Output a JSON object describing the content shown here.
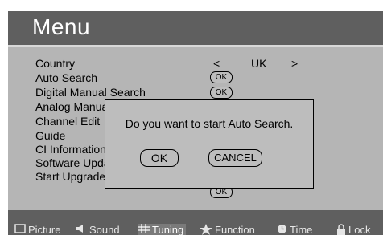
{
  "menu": {
    "title": "Menu"
  },
  "items": [
    {
      "label": "Country"
    },
    {
      "label": "Auto Search"
    },
    {
      "label": "Digital Manual Search"
    },
    {
      "label": "Analog Manual Search"
    },
    {
      "label": "Channel Edit"
    },
    {
      "label": "Guide"
    },
    {
      "label": "CI Information"
    },
    {
      "label": "Software Update"
    },
    {
      "label": "Start Upgrade"
    }
  ],
  "country": {
    "left_arrow": "<",
    "value": "UK",
    "right_arrow": ">"
  },
  "ok_label": "OK",
  "dialog": {
    "message": "Do you want to start Auto Search.",
    "ok": "OK",
    "cancel": "CANCEL"
  },
  "tabs": [
    {
      "label": "Picture",
      "icon": "monitor-icon",
      "active": false
    },
    {
      "label": "Sound",
      "icon": "speaker-icon",
      "active": false
    },
    {
      "label": "Tuning",
      "icon": "grid-icon",
      "active": true
    },
    {
      "label": "Function",
      "icon": "star-icon",
      "active": false
    },
    {
      "label": "Time",
      "icon": "clock-icon",
      "active": false
    },
    {
      "label": "Lock",
      "icon": "lock-icon",
      "active": false
    }
  ]
}
